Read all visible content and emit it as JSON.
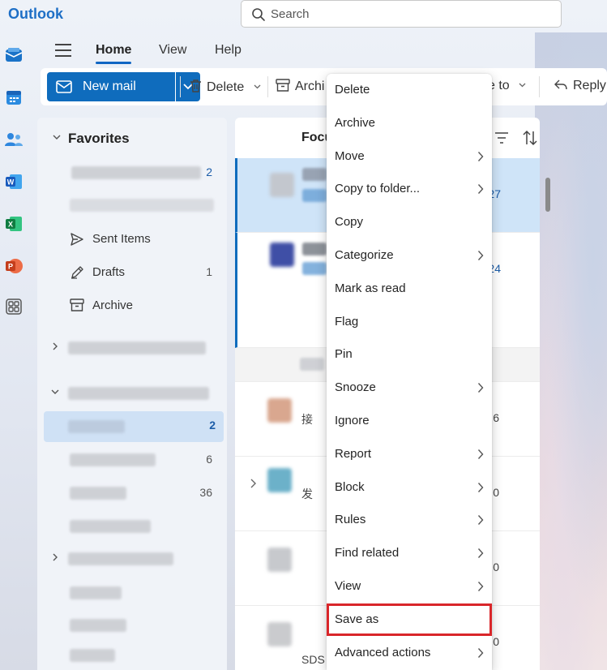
{
  "app": {
    "title": "Outlook"
  },
  "search": {
    "placeholder": "Search"
  },
  "ribbon": {
    "tabs": [
      {
        "label": "Home",
        "active": true
      },
      {
        "label": "View",
        "active": false
      },
      {
        "label": "Help",
        "active": false
      }
    ],
    "toolbar": {
      "new_mail": "New mail",
      "delete": "Delete",
      "archive": "Archi",
      "move_to": "ve to",
      "reply": "Reply"
    }
  },
  "nav": {
    "favorites_header": "Favorites",
    "favorites": [
      {
        "label": "",
        "count": "2",
        "count_color": "#1b5ca8"
      },
      {
        "label": "",
        "count": ""
      },
      {
        "label": "Sent Items",
        "count": "",
        "icon": "send-icon"
      },
      {
        "label": "Drafts",
        "count": "1",
        "icon": "pencil-icon"
      },
      {
        "label": "Archive",
        "count": "",
        "icon": "archive-icon"
      }
    ],
    "account_folders": [
      {
        "label": "",
        "count": "2",
        "selected": true
      },
      {
        "label": "",
        "count": "6"
      },
      {
        "label": "",
        "count": "36"
      },
      {
        "label": "",
        "count": ""
      }
    ]
  },
  "message_list": {
    "focused_tab": "Focu",
    "messages": [
      {
        "count": "27",
        "selected": true
      },
      {
        "count": "24"
      },
      {
        "count": ""
      },
      {
        "count": "6",
        "snippet": "接"
      },
      {
        "count": "0",
        "snippet": "发"
      },
      {
        "count": "0",
        "snippet": ""
      },
      {
        "count": "0",
        "snippet": "SDS"
      }
    ]
  },
  "context_menu": {
    "items": [
      {
        "label": "Delete",
        "submenu": false
      },
      {
        "label": "Archive",
        "submenu": false
      },
      {
        "label": "Move",
        "submenu": true
      },
      {
        "label": "Copy to folder...",
        "submenu": true
      },
      {
        "label": "Copy",
        "submenu": false
      },
      {
        "label": "Categorize",
        "submenu": true
      },
      {
        "label": "Mark as read",
        "submenu": false
      },
      {
        "label": "Flag",
        "submenu": false
      },
      {
        "label": "Pin",
        "submenu": false
      },
      {
        "label": "Snooze",
        "submenu": true
      },
      {
        "label": "Ignore",
        "submenu": false
      },
      {
        "label": "Report",
        "submenu": true
      },
      {
        "label": "Block",
        "submenu": true
      },
      {
        "label": "Rules",
        "submenu": true
      },
      {
        "label": "Find related",
        "submenu": true
      },
      {
        "label": "View",
        "submenu": true
      },
      {
        "label": "Save as",
        "submenu": false,
        "highlighted": true
      },
      {
        "label": "Advanced actions",
        "submenu": true
      }
    ]
  },
  "colors": {
    "accent": "#0f6cbd",
    "highlight_box": "#d9262a",
    "selected_bg": "#cfe4f8"
  }
}
